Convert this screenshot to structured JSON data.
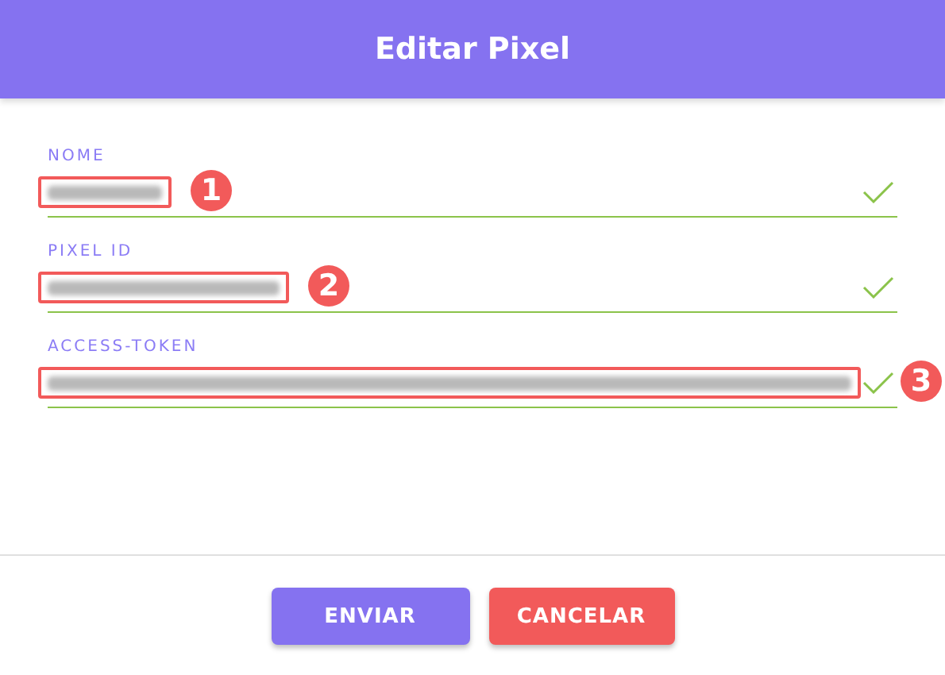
{
  "dialog": {
    "title": "Editar Pixel"
  },
  "fields": [
    {
      "label": "NOME",
      "valid": true,
      "marker": "1"
    },
    {
      "label": "PIXEL ID",
      "valid": true,
      "marker": "2"
    },
    {
      "label": "ACCESS-TOKEN",
      "valid": true,
      "marker": "3"
    }
  ],
  "buttons": [
    {
      "label": "ENVIAR",
      "kind": "primary"
    },
    {
      "label": "CANCELAR",
      "kind": "danger"
    }
  ]
}
